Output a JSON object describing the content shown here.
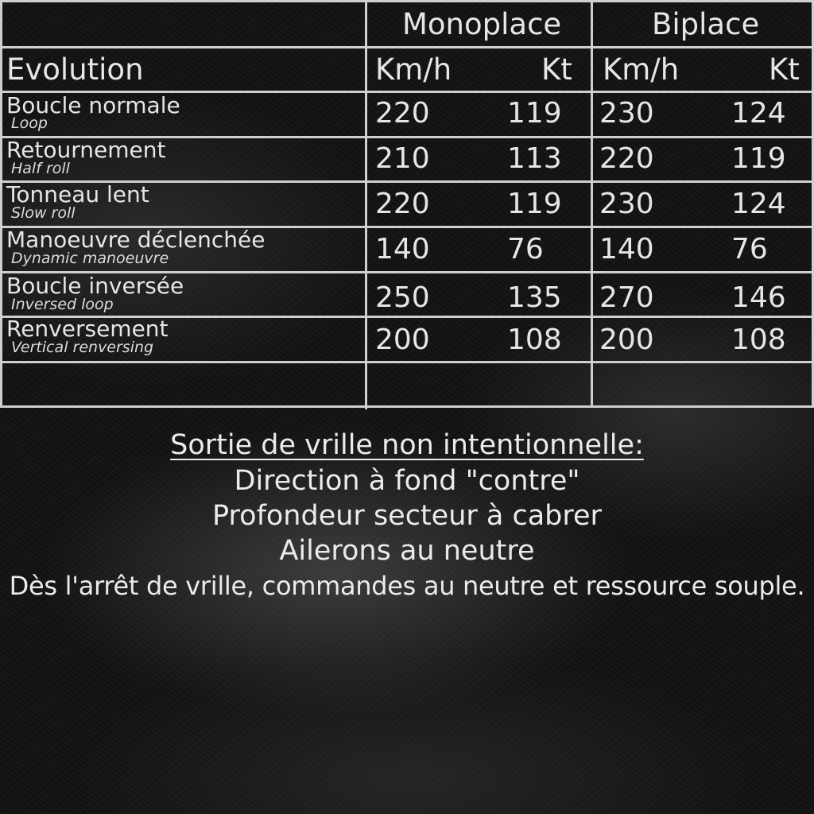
{
  "table": {
    "headers": {
      "group_1": "Monoplace",
      "group_2": "Biplace",
      "evolution": "Evolution",
      "kmh_1": "Km/h",
      "kt_1": "Kt",
      "kmh_2": "Km/h",
      "kt_2": "Kt"
    },
    "rows": [
      {
        "name": "Boucle normale",
        "sub": "Loop",
        "mono_kmh": "220",
        "mono_kt": "119",
        "bi_kmh": "230",
        "bi_kt": "124"
      },
      {
        "name": "Retournement",
        "sub": "Half roll",
        "mono_kmh": "210",
        "mono_kt": "113",
        "bi_kmh": "220",
        "bi_kt": "119"
      },
      {
        "name": "Tonneau lent",
        "sub": "Slow roll",
        "mono_kmh": "220",
        "mono_kt": "119",
        "bi_kmh": "230",
        "bi_kt": "124"
      },
      {
        "name": "Manoeuvre déclenchée",
        "sub": "Dynamic manoeuvre",
        "mono_kmh": "140",
        "mono_kt": "76",
        "bi_kmh": "140",
        "bi_kt": "76"
      },
      {
        "name": "Boucle inversée",
        "sub": "Inversed loop",
        "mono_kmh": "250",
        "mono_kt": "135",
        "bi_kmh": "270",
        "bi_kt": "146"
      },
      {
        "name": "Renversement",
        "sub": "Vertical renversing",
        "mono_kmh": "200",
        "mono_kt": "108",
        "bi_kmh": "200",
        "bi_kt": "108"
      }
    ]
  },
  "notes": {
    "title": "Sortie de vrille non intentionnelle:",
    "lines": [
      "Direction à fond \"contre\"",
      "Profondeur secteur à cabrer",
      "Ailerons au neutre",
      "Dès l'arrêt de vrille, commandes au neutre et ressource souple."
    ]
  }
}
